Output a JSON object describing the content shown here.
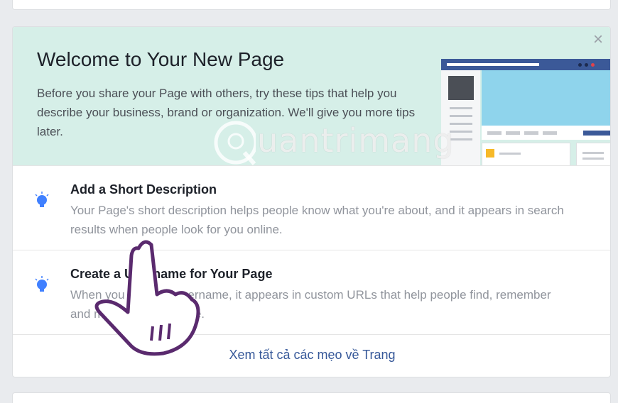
{
  "welcome": {
    "title": "Welcome to Your New Page",
    "text": "Before you share your Page with others, try these tips that help you describe your business, brand or organization. We'll give you more tips later.",
    "close_label": "×"
  },
  "tips": [
    {
      "title": "Add a Short Description",
      "desc": "Your Page's short description helps people know what you're about, and it appears in search results when people look for you online.",
      "icon": "lightbulb-icon"
    },
    {
      "title": "Create a Username for Your Page",
      "desc": "When you create a username, it appears in custom URLs that help people find, remember and message your Page.",
      "icon": "lightbulb-icon"
    }
  ],
  "see_all": "Xem tất cả các mẹo về Trang",
  "watermark": "uantrimang",
  "colors": {
    "hero_bg": "#d6efe8",
    "link": "#365899",
    "icon_blue": "#4080ff",
    "brand": "#3b5998"
  }
}
